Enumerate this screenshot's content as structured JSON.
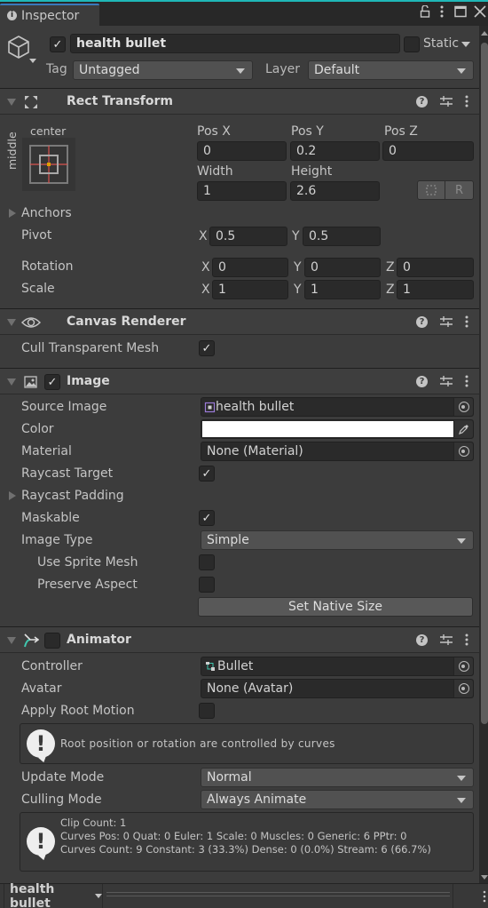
{
  "window": {
    "tab_label": "Inspector",
    "controls": [
      "lock-icon",
      "more-icon",
      "maximize-icon",
      "close-icon"
    ]
  },
  "gameobject": {
    "active": true,
    "name": "health bullet",
    "static_label": "Static",
    "static": false,
    "tag_label": "Tag",
    "tag_value": "Untagged",
    "layer_label": "Layer",
    "layer_value": "Default"
  },
  "rect_transform": {
    "title": "Rect Transform",
    "anchor_h": "center",
    "anchor_v": "middle",
    "pos_x_label": "Pos X",
    "pos_x": "0",
    "pos_y_label": "Pos Y",
    "pos_y": "0.2",
    "pos_z_label": "Pos Z",
    "pos_z": "0",
    "width_label": "Width",
    "width": "1",
    "height_label": "Height",
    "height": "2.6",
    "raw_button": "R",
    "anchors_label": "Anchors",
    "pivot_label": "Pivot",
    "pivot_x": "0.5",
    "pivot_y": "0.5",
    "rotation_label": "Rotation",
    "rot_x": "0",
    "rot_y": "0",
    "rot_z": "0",
    "scale_label": "Scale",
    "scale_x": "1",
    "scale_y": "1",
    "scale_z": "1",
    "axis_x": "X",
    "axis_y": "Y",
    "axis_z": "Z"
  },
  "canvas_renderer": {
    "title": "Canvas Renderer",
    "cull_label": "Cull Transparent Mesh",
    "cull": true
  },
  "image": {
    "title": "Image",
    "enabled": true,
    "source_label": "Source Image",
    "source_value": "health bullet",
    "color_label": "Color",
    "color_value": "#ffffff",
    "material_label": "Material",
    "material_value": "None (Material)",
    "raycast_label": "Raycast Target",
    "raycast": true,
    "raycast_padding_label": "Raycast Padding",
    "maskable_label": "Maskable",
    "maskable": true,
    "image_type_label": "Image Type",
    "image_type_value": "Simple",
    "sprite_mesh_label": "Use Sprite Mesh",
    "sprite_mesh": false,
    "preserve_label": "Preserve Aspect",
    "preserve": false,
    "native_size_button": "Set Native Size"
  },
  "animator": {
    "title": "Animator",
    "enabled": false,
    "controller_label": "Controller",
    "controller_value": "Bullet",
    "avatar_label": "Avatar",
    "avatar_value": "None (Avatar)",
    "root_motion_label": "Apply Root Motion",
    "root_motion": false,
    "root_help": "Root position or rotation are controlled by curves",
    "update_label": "Update Mode",
    "update_value": "Normal",
    "culling_label": "Culling Mode",
    "culling_value": "Always Animate",
    "stats_line1": "Clip Count: 1",
    "stats_line2": "Curves Pos: 0 Quat: 0 Euler: 1 Scale: 0 Muscles: 0 Generic: 6 PPtr: 0",
    "stats_line3": "Curves Count: 9 Constant: 3 (33.3%) Dense: 0 (0.0%) Stream: 6 (66.7%)"
  },
  "bottom": {
    "selection_label": "health bullet"
  },
  "colors": {
    "accent_line": "#1fb7b7",
    "tab_highlight": "#3a79bb",
    "anchor_cross": "#d9534f",
    "anchor_pivot": "#e0a000",
    "sprite_icon": "#9b7bd8",
    "animator_icon": "#40c8b0"
  }
}
